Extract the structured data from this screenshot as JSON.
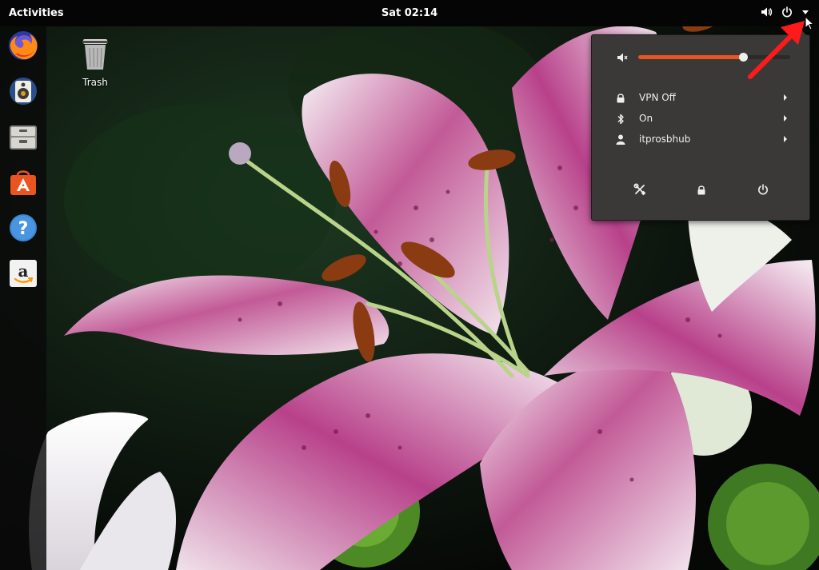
{
  "topbar": {
    "activities_label": "Activities",
    "clock_label": "Sat 02:14",
    "tray_icons": [
      "speaker-icon",
      "power-icon",
      "chevron-down-icon"
    ]
  },
  "dock": {
    "apps": [
      {
        "name": "firefox",
        "icon": "firefox-icon"
      },
      {
        "name": "rhythmbox",
        "icon": "rhythmbox-icon"
      },
      {
        "name": "files",
        "icon": "files-icon"
      },
      {
        "name": "software",
        "icon": "software-store-icon"
      },
      {
        "name": "help",
        "icon": "help-icon"
      },
      {
        "name": "amazon",
        "icon": "amazon-icon"
      }
    ]
  },
  "desktop": {
    "trash_label": "Trash"
  },
  "system_menu": {
    "volume_level": 0.69,
    "vpn_label": "VPN Off",
    "bluetooth_label": "On",
    "user_label": "itprosbhub",
    "buttons": [
      "settings-icon",
      "lock-icon",
      "power-icon"
    ]
  },
  "colors": {
    "accent": "#e95420",
    "menu_bg": "#3a3938",
    "topbar_bg": "#050505",
    "annotation": "#ff1a1a"
  }
}
